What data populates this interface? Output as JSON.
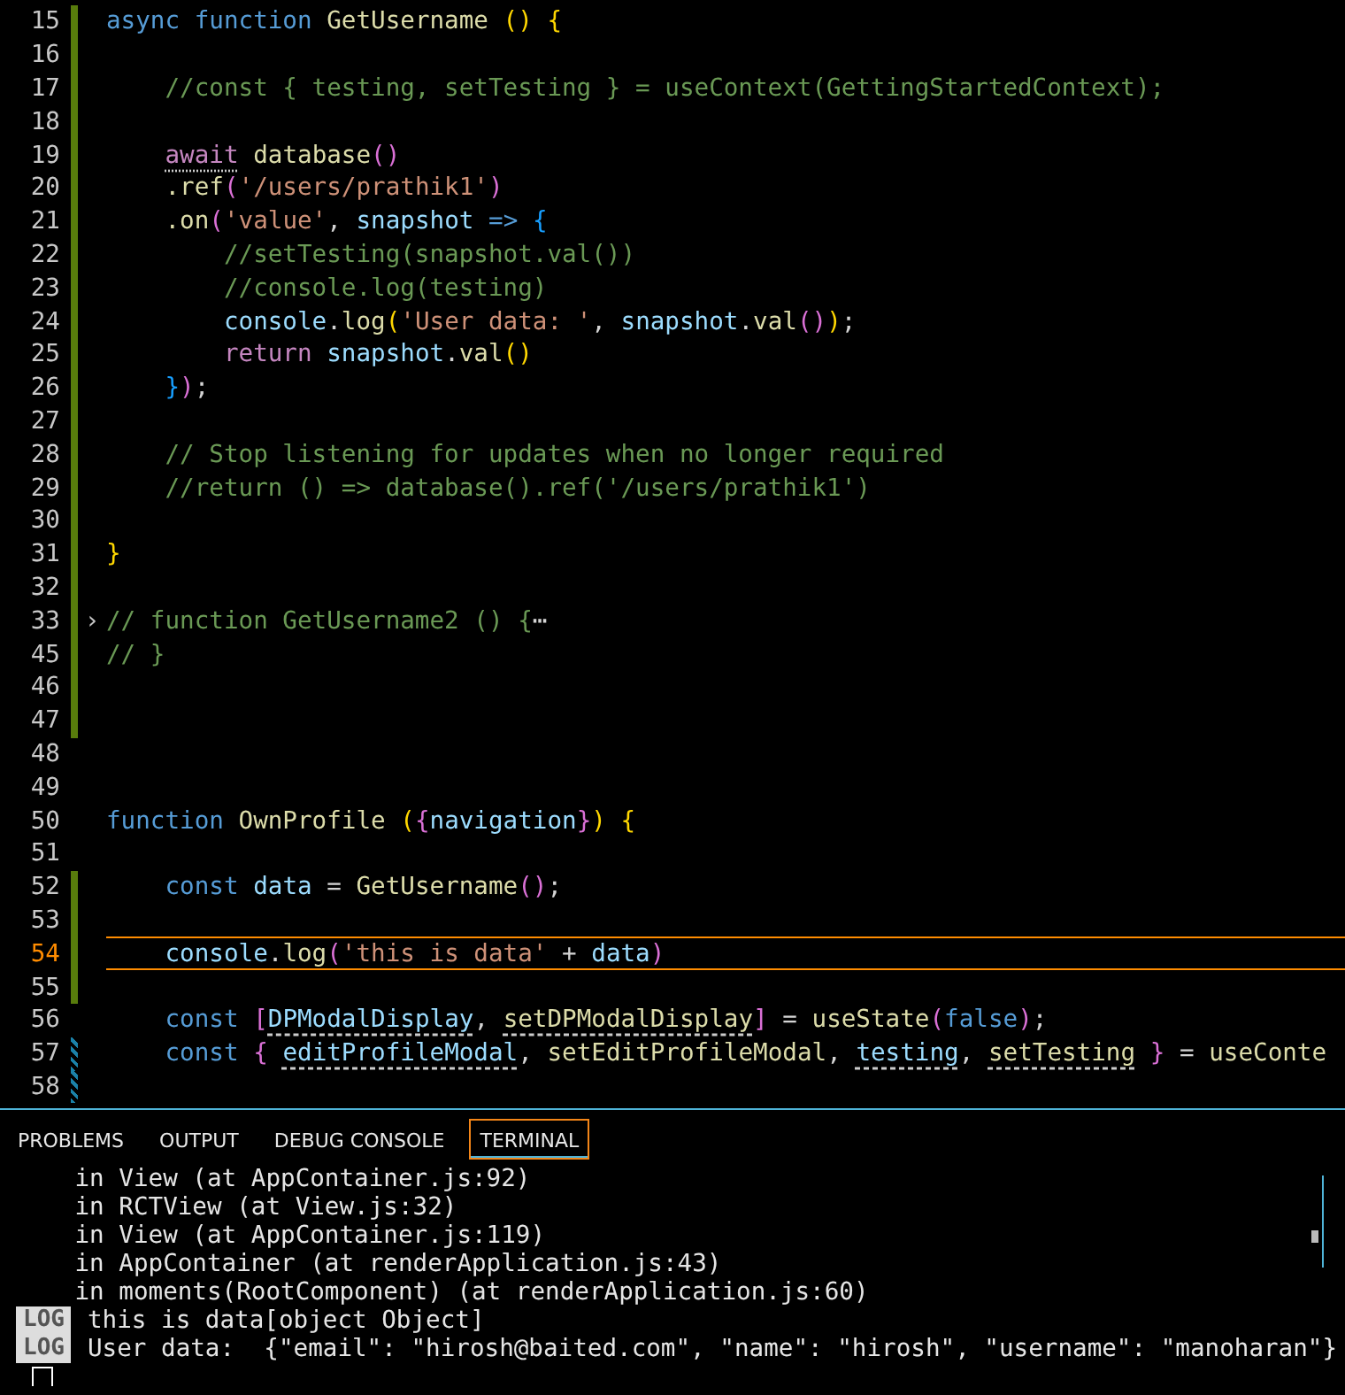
{
  "editor": {
    "lines": [
      {
        "number": "15",
        "added": true,
        "modified": false,
        "current": false,
        "tokens": [
          {
            "text": "async function ",
            "kind": "keyword"
          },
          {
            "text": "GetUsername ",
            "kind": "func"
          },
          {
            "text": "() ",
            "kind": "brace1"
          },
          {
            "text": "{",
            "kind": "brace1"
          }
        ]
      },
      {
        "number": "16",
        "added": true,
        "modified": false,
        "current": false
      },
      {
        "number": "17",
        "added": true,
        "modified": false,
        "current": false,
        "tokens": [
          {
            "text": "    //const { testing, setTesting } = useContext(GettingStartedContext);",
            "kind": "comment"
          }
        ]
      },
      {
        "number": "18",
        "added": true,
        "modified": false,
        "current": false
      },
      {
        "number": "19",
        "added": true,
        "modified": false,
        "current": false,
        "tokens": [
          {
            "text": "    await",
            "kind": "control",
            "hint": true
          },
          {
            "text": " database",
            "kind": "func"
          },
          {
            "text": "()",
            "kind": "brace2"
          }
        ]
      },
      {
        "number": "20",
        "added": true,
        "modified": false,
        "current": false,
        "tokens": [
          {
            "text": "    .ref",
            "kind": "func"
          },
          {
            "text": "(",
            "kind": "brace2"
          },
          {
            "text": "'/users/prathik1'",
            "kind": "string"
          },
          {
            "text": ")",
            "kind": "brace2"
          }
        ]
      },
      {
        "number": "21",
        "added": true,
        "modified": false,
        "current": false,
        "tokens": [
          {
            "text": "    .on",
            "kind": "func"
          },
          {
            "text": "(",
            "kind": "brace2"
          },
          {
            "text": "'value'",
            "kind": "string"
          },
          {
            "text": ", ",
            "kind": "punct"
          },
          {
            "text": "snapshot ",
            "kind": "var"
          },
          {
            "text": "=> ",
            "kind": "keyword"
          },
          {
            "text": "{",
            "kind": "brace3"
          }
        ]
      },
      {
        "number": "22",
        "added": true,
        "modified": false,
        "current": false,
        "tokens": [
          {
            "text": "        //setTesting(snapshot.val())",
            "kind": "comment"
          }
        ]
      },
      {
        "number": "23",
        "added": true,
        "modified": false,
        "current": false,
        "tokens": [
          {
            "text": "        //console.log(testing)",
            "kind": "comment"
          }
        ]
      },
      {
        "number": "24",
        "added": true,
        "modified": false,
        "current": false,
        "tokens": [
          {
            "text": "        console",
            "kind": "var"
          },
          {
            "text": ".",
            "kind": "punct"
          },
          {
            "text": "log",
            "kind": "func"
          },
          {
            "text": "(",
            "kind": "brace1"
          },
          {
            "text": "'User data: '",
            "kind": "string"
          },
          {
            "text": ", ",
            "kind": "punct"
          },
          {
            "text": "snapshot",
            "kind": "var"
          },
          {
            "text": ".",
            "kind": "punct"
          },
          {
            "text": "val",
            "kind": "func"
          },
          {
            "text": "()",
            "kind": "brace2"
          },
          {
            "text": ")",
            "kind": "brace1"
          },
          {
            "text": ";",
            "kind": "punct"
          }
        ]
      },
      {
        "number": "25",
        "added": true,
        "modified": false,
        "current": false,
        "tokens": [
          {
            "text": "        return ",
            "kind": "control"
          },
          {
            "text": "snapshot",
            "kind": "var"
          },
          {
            "text": ".",
            "kind": "punct"
          },
          {
            "text": "val",
            "kind": "func"
          },
          {
            "text": "()",
            "kind": "brace1"
          }
        ]
      },
      {
        "number": "26",
        "added": true,
        "modified": false,
        "current": false,
        "tokens": [
          {
            "text": "    }",
            "kind": "brace3"
          },
          {
            "text": ")",
            "kind": "brace2"
          },
          {
            "text": ";",
            "kind": "punct"
          }
        ]
      },
      {
        "number": "27",
        "added": true,
        "modified": false,
        "current": false
      },
      {
        "number": "28",
        "added": true,
        "modified": false,
        "current": false,
        "tokens": [
          {
            "text": "    // Stop listening for updates when no longer required",
            "kind": "comment"
          }
        ]
      },
      {
        "number": "29",
        "added": true,
        "modified": false,
        "current": false,
        "tokens": [
          {
            "text": "    //return () => database().ref('/users/prathik1')",
            "kind": "comment"
          }
        ]
      },
      {
        "number": "30",
        "added": true,
        "modified": false,
        "current": false
      },
      {
        "number": "31",
        "added": true,
        "modified": false,
        "current": false,
        "tokens": [
          {
            "text": "}",
            "kind": "brace1"
          }
        ]
      },
      {
        "number": "32",
        "added": true,
        "modified": false,
        "current": false
      },
      {
        "number": "33",
        "added": true,
        "modified": false,
        "current": false,
        "fold": "›",
        "tokens": [
          {
            "text": "// function GetUsername2 () {",
            "kind": "comment"
          },
          {
            "text": "⋯",
            "kind": "punct"
          }
        ]
      },
      {
        "number": "45",
        "added": true,
        "modified": false,
        "current": false,
        "tokens": [
          {
            "text": "// }",
            "kind": "comment"
          }
        ]
      },
      {
        "number": "46",
        "added": true,
        "modified": false,
        "current": false
      },
      {
        "number": "47",
        "added": true,
        "modified": false,
        "current": false
      },
      {
        "number": "48",
        "added": false,
        "modified": false,
        "current": false
      },
      {
        "number": "49",
        "added": false,
        "modified": false,
        "current": false
      },
      {
        "number": "50",
        "added": false,
        "modified": false,
        "current": false,
        "tokens": [
          {
            "text": "function ",
            "kind": "keyword"
          },
          {
            "text": "OwnProfile ",
            "kind": "func"
          },
          {
            "text": "(",
            "kind": "brace1"
          },
          {
            "text": "{",
            "kind": "brace2"
          },
          {
            "text": "navigation",
            "kind": "var"
          },
          {
            "text": "}",
            "kind": "brace2"
          },
          {
            "text": ") {",
            "kind": "brace1"
          }
        ]
      },
      {
        "number": "51",
        "added": false,
        "modified": false,
        "current": false
      },
      {
        "number": "52",
        "added": true,
        "modified": false,
        "current": false,
        "tokens": [
          {
            "text": "    const ",
            "kind": "keyword"
          },
          {
            "text": "data",
            "kind": "var"
          },
          {
            "text": " = ",
            "kind": "punct"
          },
          {
            "text": "GetUsername",
            "kind": "func"
          },
          {
            "text": "()",
            "kind": "brace2"
          },
          {
            "text": ";",
            "kind": "punct"
          }
        ]
      },
      {
        "number": "53",
        "added": true,
        "modified": false,
        "current": false
      },
      {
        "number": "54",
        "added": true,
        "modified": false,
        "current": true,
        "tokens": [
          {
            "text": "    console",
            "kind": "var"
          },
          {
            "text": ".",
            "kind": "punct"
          },
          {
            "text": "log",
            "kind": "func"
          },
          {
            "text": "(",
            "kind": "brace2"
          },
          {
            "text": "'this is data'",
            "kind": "string"
          },
          {
            "text": " + ",
            "kind": "punct"
          },
          {
            "text": "data",
            "kind": "var"
          },
          {
            "text": ")",
            "kind": "brace2"
          }
        ]
      },
      {
        "number": "55",
        "added": true,
        "modified": false,
        "current": false
      },
      {
        "number": "56",
        "added": false,
        "modified": false,
        "current": false,
        "tokens": [
          {
            "text": "    const ",
            "kind": "keyword"
          },
          {
            "text": "[",
            "kind": "brace2"
          },
          {
            "text": "DPModalDisplay",
            "kind": "var",
            "warning": true
          },
          {
            "text": ", ",
            "kind": "punct"
          },
          {
            "text": "setDPModalDisplay",
            "kind": "func",
            "warning": true
          },
          {
            "text": "]",
            "kind": "brace2"
          },
          {
            "text": " = ",
            "kind": "punct"
          },
          {
            "text": "useState",
            "kind": "func"
          },
          {
            "text": "(",
            "kind": "brace2"
          },
          {
            "text": "false",
            "kind": "keyword"
          },
          {
            "text": ")",
            "kind": "brace2"
          },
          {
            "text": ";",
            "kind": "punct"
          }
        ]
      },
      {
        "number": "57",
        "added": false,
        "modified": true,
        "current": false,
        "tokens": [
          {
            "text": "    const ",
            "kind": "keyword"
          },
          {
            "text": "{ ",
            "kind": "brace2"
          },
          {
            "text": "editProfileModal",
            "kind": "var",
            "warning": true
          },
          {
            "text": ", ",
            "kind": "punct"
          },
          {
            "text": "setEditProfileModal",
            "kind": "func"
          },
          {
            "text": ", ",
            "kind": "punct"
          },
          {
            "text": "testing",
            "kind": "var",
            "warning": true
          },
          {
            "text": ", ",
            "kind": "punct"
          },
          {
            "text": "setTesting",
            "kind": "func",
            "warning": true
          },
          {
            "text": " }",
            "kind": "brace2"
          },
          {
            "text": " = ",
            "kind": "punct"
          },
          {
            "text": "useConte",
            "kind": "func"
          }
        ]
      },
      {
        "number": "58",
        "added": false,
        "modified": true,
        "current": false
      }
    ]
  },
  "panel": {
    "tabs": [
      {
        "label": "PROBLEMS",
        "selected": false
      },
      {
        "label": "OUTPUT",
        "selected": false
      },
      {
        "label": "DEBUG CONSOLE",
        "selected": false
      },
      {
        "label": "TERMINAL",
        "selected": true
      }
    ],
    "terminal": [
      {
        "kind": "text",
        "text": "    in View (at AppContainer.js:92)"
      },
      {
        "kind": "text",
        "text": "    in RCTView (at View.js:32)"
      },
      {
        "kind": "text",
        "text": "    in View (at AppContainer.js:119)"
      },
      {
        "kind": "text",
        "text": "    in AppContainer (at renderApplication.js:43)"
      },
      {
        "kind": "text",
        "text": "    in moments(RootComponent) (at renderApplication.js:60)"
      },
      {
        "kind": "log",
        "badge": "LOG",
        "text": "this is data[object Object]"
      },
      {
        "kind": "log",
        "badge": "LOG",
        "text": "User data:  {\"email\": \"hirosh@baited.com\", \"name\": \"hirosh\", \"username\": \"manoharan\"}"
      }
    ]
  }
}
